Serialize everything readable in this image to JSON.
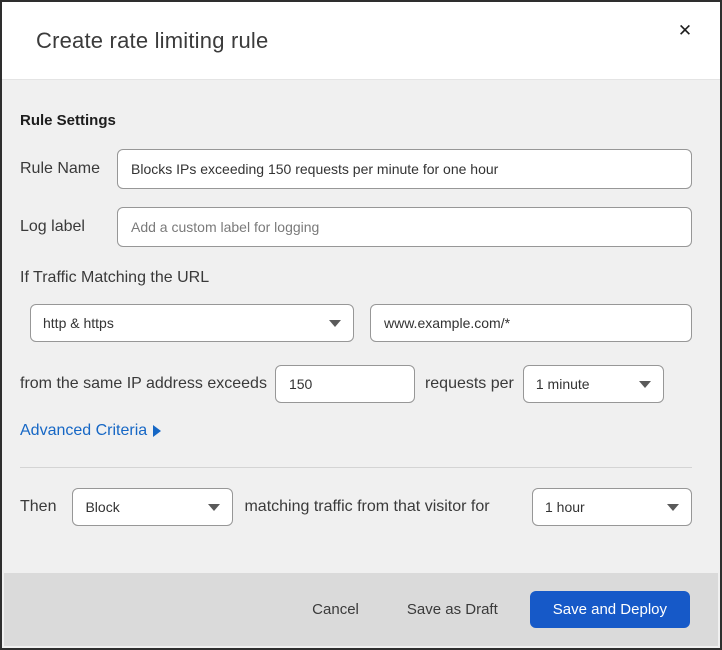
{
  "dialog": {
    "title": "Create rate limiting rule",
    "close_icon": "✕"
  },
  "rule_settings": {
    "heading": "Rule Settings",
    "rule_name": {
      "label": "Rule Name",
      "value": "Blocks IPs exceeding 150 requests per minute for one hour"
    },
    "log_label": {
      "label": "Log label",
      "placeholder": "Add a custom label for logging"
    }
  },
  "match": {
    "intro": "If Traffic Matching the URL",
    "scheme_selected": "http & https",
    "url_value": "www.example.com/*",
    "exceeds_label": "from the same IP address exceeds",
    "threshold_value": "150",
    "requests_per_label": "requests per",
    "period_selected": "1 minute",
    "advanced_link": "Advanced Criteria"
  },
  "action": {
    "then_label": "Then",
    "action_selected": "Block",
    "matching_label": "matching traffic from that visitor for",
    "duration_selected": "1 hour"
  },
  "footer": {
    "cancel_label": "Cancel",
    "save_draft_label": "Save as Draft",
    "save_deploy_label": "Save and Deploy"
  },
  "colors": {
    "primary_button_blue": "#1659c8",
    "link_blue": "#1667c5",
    "top_accent_navy": "#0c2233",
    "body_gray": "#f0f0f0",
    "footer_gray": "#dadada"
  }
}
